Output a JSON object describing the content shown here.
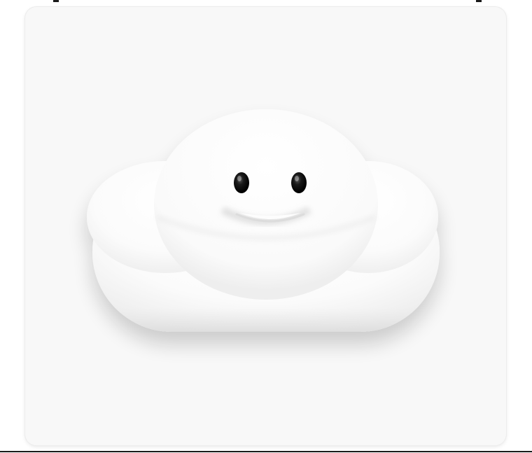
{
  "card": {
    "background": "#f8f8f8"
  },
  "mascot": {
    "name": "cloud-mascot",
    "body_color": "#fdfdfd",
    "eye_color": "#0d0d0d",
    "expression": "smile"
  }
}
